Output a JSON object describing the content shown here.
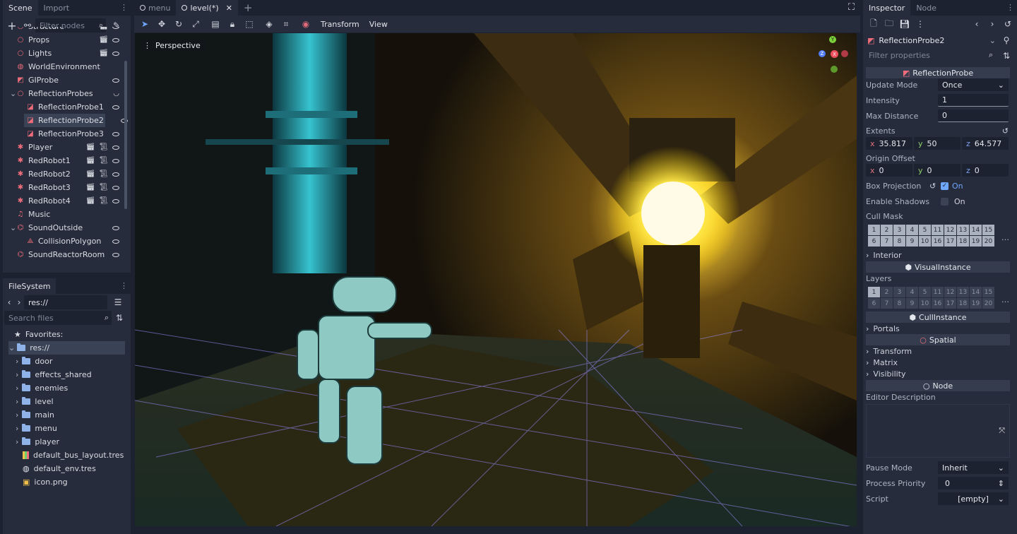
{
  "scene_dock": {
    "tabs": [
      "Scene",
      "Import"
    ],
    "filter_placeholder": "Filter nodes",
    "nodes": [
      {
        "label": "Structure",
        "icon": "node-circle-icon",
        "indent": 1
      },
      {
        "label": "Props",
        "icon": "node-circle-icon",
        "indent": 1
      },
      {
        "label": "Lights",
        "icon": "node-circle-icon",
        "indent": 1
      },
      {
        "label": "WorldEnvironment",
        "icon": "world-environment-icon",
        "indent": 1
      },
      {
        "label": "GIProbe",
        "icon": "giprobe-icon",
        "indent": 1
      },
      {
        "label": "ReflectionProbes",
        "icon": "node-circle-icon",
        "indent": 1
      },
      {
        "label": "ReflectionProbe1",
        "icon": "reflection-probe-icon",
        "indent": 2
      },
      {
        "label": "ReflectionProbe2",
        "icon": "reflection-probe-icon",
        "indent": 2,
        "selected": true
      },
      {
        "label": "ReflectionProbe3",
        "icon": "reflection-probe-icon",
        "indent": 2
      },
      {
        "label": "Player",
        "icon": "character-icon",
        "indent": 1
      },
      {
        "label": "RedRobot1",
        "icon": "character-icon",
        "indent": 1
      },
      {
        "label": "RedRobot2",
        "icon": "character-icon",
        "indent": 1
      },
      {
        "label": "RedRobot3",
        "icon": "character-icon",
        "indent": 1
      },
      {
        "label": "RedRobot4",
        "icon": "character-icon",
        "indent": 1
      },
      {
        "label": "Music",
        "icon": "audio-icon",
        "indent": 1
      },
      {
        "label": "SoundOutside",
        "icon": "audio-area-icon",
        "indent": 1
      },
      {
        "label": "CollisionPolygon",
        "icon": "collision-polygon-icon",
        "indent": 2
      },
      {
        "label": "SoundReactorRoom",
        "icon": "audio-area-icon",
        "indent": 1
      }
    ]
  },
  "filesystem": {
    "tab": "FileSystem",
    "path": "res://",
    "search_placeholder": "Search files",
    "favorites": "Favorites:",
    "root": "res://",
    "folders": [
      "door",
      "effects_shared",
      "enemies",
      "level",
      "main",
      "menu",
      "player"
    ],
    "files": [
      "default_bus_layout.tres",
      "default_env.tres",
      "icon.png"
    ]
  },
  "editor_tabs": [
    "menu",
    "level(*)"
  ],
  "viewport": {
    "toolbar_menus": [
      "Transform",
      "View"
    ],
    "perspective_label": "Perspective",
    "gizmo_axes": [
      "Y",
      "X",
      "Z"
    ]
  },
  "inspector": {
    "tabs": [
      "Inspector",
      "Node"
    ],
    "node_name": "ReflectionProbe2",
    "filter_placeholder": "Filter properties",
    "class_header": "ReflectionProbe",
    "update_mode": {
      "label": "Update Mode",
      "value": "Once"
    },
    "intensity": {
      "label": "Intensity",
      "value": "1"
    },
    "max_distance": {
      "label": "Max Distance",
      "value": "0"
    },
    "extents": {
      "label": "Extents",
      "x": "35.817",
      "y": "50",
      "z": "64.577"
    },
    "origin_offset": {
      "label": "Origin Offset",
      "x": "0",
      "y": "0",
      "z": "0"
    },
    "box_projection": {
      "label": "Box Projection",
      "value": "On"
    },
    "enable_shadows": {
      "label": "Enable Shadows",
      "value": "On"
    },
    "cull_mask": {
      "label": "Cull Mask",
      "cells": [
        "1",
        "2",
        "3",
        "4",
        "5",
        "11",
        "12",
        "13",
        "14",
        "15",
        "6",
        "7",
        "8",
        "9",
        "10",
        "16",
        "17",
        "18",
        "19",
        "20"
      ]
    },
    "interior": "Interior",
    "visual_instance": "VisualInstance",
    "layers": {
      "label": "Layers",
      "cells": [
        "1",
        "2",
        "3",
        "4",
        "5",
        "11",
        "12",
        "13",
        "14",
        "15",
        "6",
        "7",
        "8",
        "9",
        "10",
        "16",
        "17",
        "18",
        "19",
        "20"
      ]
    },
    "cull_instance": "CullInstance",
    "portals": "Portals",
    "spatial": "Spatial",
    "transform": "Transform",
    "matrix": "Matrix",
    "visibility": "Visibility",
    "node": "Node",
    "editor_description": "Editor Description",
    "pause_mode": {
      "label": "Pause Mode",
      "value": "Inherit"
    },
    "process_priority": {
      "label": "Process Priority",
      "value": "0"
    },
    "script": {
      "label": "Script",
      "value": "[empty]"
    }
  }
}
